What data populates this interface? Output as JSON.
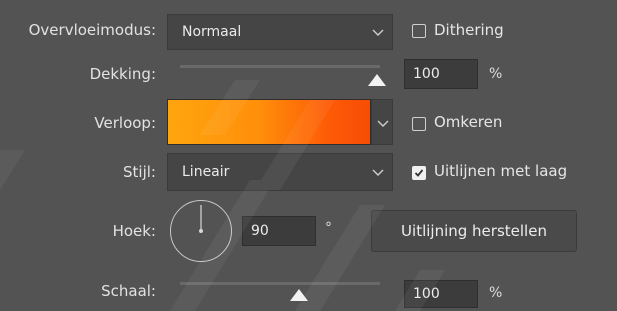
{
  "blend_mode": {
    "label": "Overvloeimodus:",
    "value": "Normaal"
  },
  "dithering": {
    "label": "Dithering",
    "checked": false
  },
  "opacity": {
    "label": "Dekking:",
    "value": "100",
    "unit": "%",
    "fraction": 1.0
  },
  "gradient": {
    "label": "Verloop:",
    "colors": [
      "#ffa50e",
      "#ff8f0a",
      "#f74d05"
    ]
  },
  "reverse": {
    "label": "Omkeren",
    "checked": false
  },
  "style": {
    "label": "Stijl:",
    "value": "Lineair"
  },
  "align_with_layer": {
    "label": "Uitlijnen met laag",
    "checked": true
  },
  "angle": {
    "label": "Hoek:",
    "value": "90",
    "unit": "°"
  },
  "reset_alignment": {
    "label": "Uitlijning herstellen"
  },
  "scale": {
    "label": "Schaal:",
    "value": "100",
    "unit": "%",
    "fraction": 0.6
  },
  "icons": {
    "chevron": "chevron-down-icon",
    "check": "checkmark-icon"
  },
  "colors": {
    "panel": "#535353",
    "field": "#454545",
    "input": "#3c3c3c",
    "text": "#e6e6e6"
  }
}
